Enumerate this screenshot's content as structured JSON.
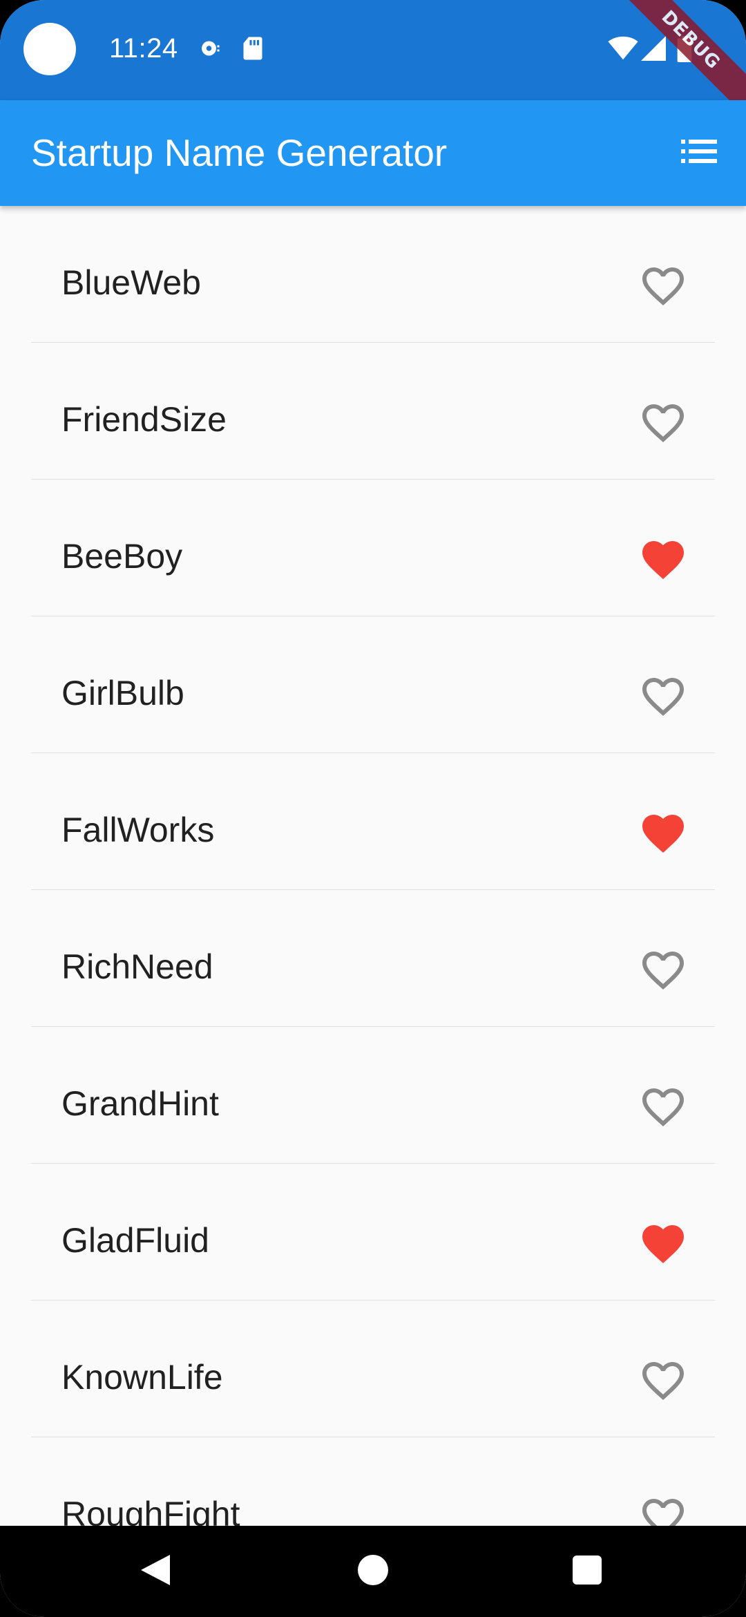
{
  "status_bar": {
    "time": "11:24"
  },
  "debug_banner": "DEBUG",
  "app_bar": {
    "title": "Startup Name Generator",
    "action_icon": "list-icon"
  },
  "colors": {
    "status_bar": "#1976d2",
    "app_bar": "#2196f3",
    "favorite": "#f44336",
    "not_favorite": "#8a8a8a"
  },
  "list": {
    "items": [
      {
        "label": "BlueWeb",
        "favorited": false
      },
      {
        "label": "FriendSize",
        "favorited": false
      },
      {
        "label": "BeeBoy",
        "favorited": true
      },
      {
        "label": "GirlBulb",
        "favorited": false
      },
      {
        "label": "FallWorks",
        "favorited": true
      },
      {
        "label": "RichNeed",
        "favorited": false
      },
      {
        "label": "GrandHint",
        "favorited": false
      },
      {
        "label": "GladFluid",
        "favorited": true
      },
      {
        "label": "KnownLife",
        "favorited": false
      },
      {
        "label": "RoughFight",
        "favorited": false
      }
    ]
  },
  "nav_bar": {
    "back_icon": "back-icon",
    "home_icon": "home-icon",
    "recents_icon": "recents-icon"
  }
}
